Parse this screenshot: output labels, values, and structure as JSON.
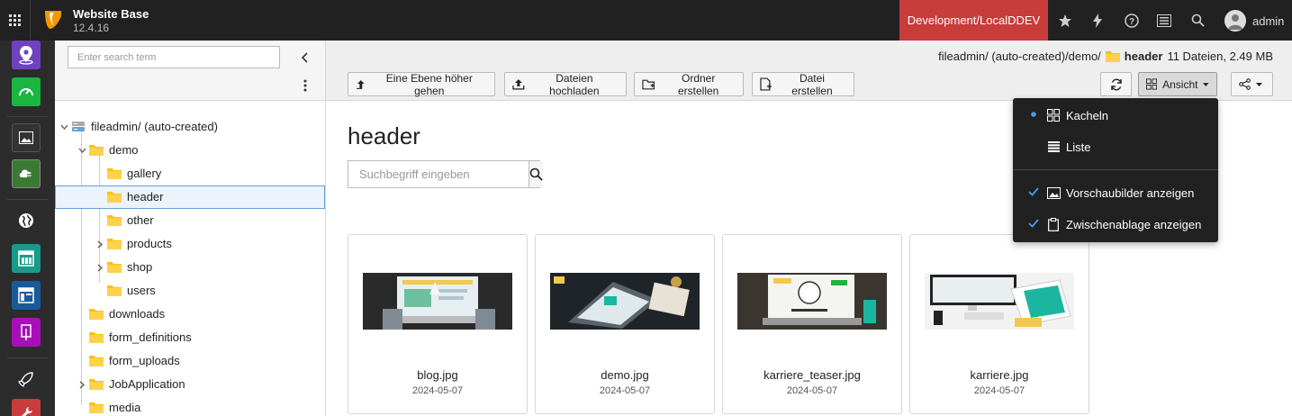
{
  "topbar": {
    "site_name": "Website Base",
    "version": "12.4.16",
    "environment": "Development/LocalDDEV",
    "username": "admin",
    "env_color": "#c83c3c"
  },
  "modules": [
    {
      "name": "sites-module",
      "color": "#6f42c1"
    },
    {
      "name": "dashboard-module",
      "color": "#1bb641"
    },
    {
      "name": "media-module",
      "color": "#333333"
    },
    {
      "name": "filelist-module",
      "color": "#3b7a33"
    },
    {
      "name": "web-module",
      "color": "#2c2c2c"
    },
    {
      "name": "page-module",
      "color": "#1a9a8a"
    },
    {
      "name": "list-module",
      "color": "#1b5a9a"
    },
    {
      "name": "form-module",
      "color": "#a80fb8"
    },
    {
      "name": "launch-module",
      "color": "#2c2c2c"
    },
    {
      "name": "extension-module",
      "color": "#c83c3c"
    }
  ],
  "tree": {
    "search_placeholder": "Enter search term",
    "nodes": [
      {
        "label": "fileadmin/ (auto-created)",
        "depth": 0,
        "type": "storage",
        "expanded": true
      },
      {
        "label": "demo",
        "depth": 1,
        "type": "folder",
        "expanded": true
      },
      {
        "label": "gallery",
        "depth": 2,
        "type": "folder"
      },
      {
        "label": "header",
        "depth": 2,
        "type": "folder",
        "selected": true
      },
      {
        "label": "other",
        "depth": 2,
        "type": "folder"
      },
      {
        "label": "products",
        "depth": 2,
        "type": "folder",
        "collapsed": true
      },
      {
        "label": "shop",
        "depth": 2,
        "type": "folder",
        "collapsed": true
      },
      {
        "label": "users",
        "depth": 2,
        "type": "folder"
      },
      {
        "label": "downloads",
        "depth": 1,
        "type": "folder"
      },
      {
        "label": "form_definitions",
        "depth": 1,
        "type": "folder"
      },
      {
        "label": "form_uploads",
        "depth": 1,
        "type": "folder"
      },
      {
        "label": "JobApplication",
        "depth": 1,
        "type": "folder",
        "collapsed": true
      },
      {
        "label": "media",
        "depth": 1,
        "type": "folder"
      }
    ]
  },
  "header": {
    "path": "fileadmin/ (auto-created)/demo/",
    "folder": "header",
    "summary": "11 Dateien, 2.49 MB",
    "buttons": {
      "up": "Eine Ebene höher gehen",
      "upload": "Dateien hochladen",
      "new_folder": "Ordner erstellen",
      "new_file": "Datei erstellen",
      "view": "Ansicht"
    }
  },
  "content": {
    "title": "header",
    "search_placeholder": "Suchbegriff eingeben",
    "files": [
      {
        "name": "blog.jpg",
        "date": "2024-05-07"
      },
      {
        "name": "demo.jpg",
        "date": "2024-05-07"
      },
      {
        "name": "karriere_teaser.jpg",
        "date": "2024-05-07"
      },
      {
        "name": "karriere.jpg",
        "date": "2024-05-07"
      }
    ]
  },
  "view_menu": {
    "tiles": "Kacheln",
    "list": "Liste",
    "show_thumbnails": "Vorschaubilder anzeigen",
    "show_clipboard": "Zwischenablage anzeigen",
    "active_mode": "Kacheln",
    "checked_color": "#4c9be8"
  }
}
